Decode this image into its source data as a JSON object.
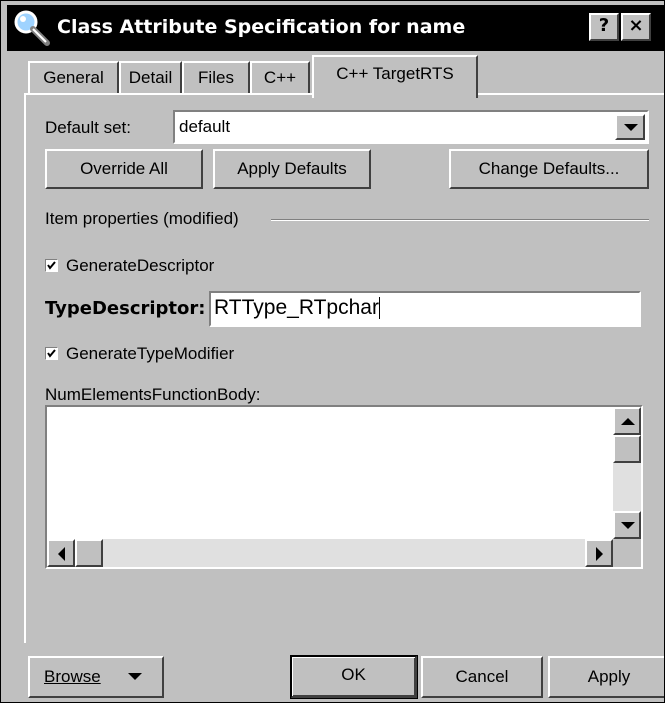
{
  "window": {
    "title": "Class Attribute Specification for name",
    "icon": "magnifier-icon",
    "help_label": "?",
    "close_label": "×"
  },
  "tabs": [
    {
      "label": "General",
      "active": false
    },
    {
      "label": "Detail",
      "active": false
    },
    {
      "label": "Files",
      "active": false
    },
    {
      "label": "C++",
      "active": false
    },
    {
      "label": "C++ TargetRTS",
      "active": true
    }
  ],
  "panel": {
    "default_set_label": "Default set:",
    "default_set_value": "default",
    "override_all_label": "Override All",
    "apply_defaults_label": "Apply Defaults",
    "change_defaults_label": "Change Defaults...",
    "group_label": "Item properties (modified)",
    "generate_descriptor_label": "GenerateDescriptor",
    "generate_descriptor_checked": true,
    "type_descriptor_label": "TypeDescriptor:",
    "type_descriptor_value": "RTType_RTpchar",
    "generate_type_modifier_label": "GenerateTypeModifier",
    "generate_type_modifier_checked": true,
    "num_elements_label": "NumElementsFunctionBody:",
    "num_elements_value": ""
  },
  "footer": {
    "browse_label": "Browse",
    "ok_label": "OK",
    "cancel_label": "Cancel",
    "apply_label": "Apply"
  },
  "colors": {
    "face": "#c0c0c0",
    "titlebar": "#000000",
    "field": "#ffffff"
  }
}
